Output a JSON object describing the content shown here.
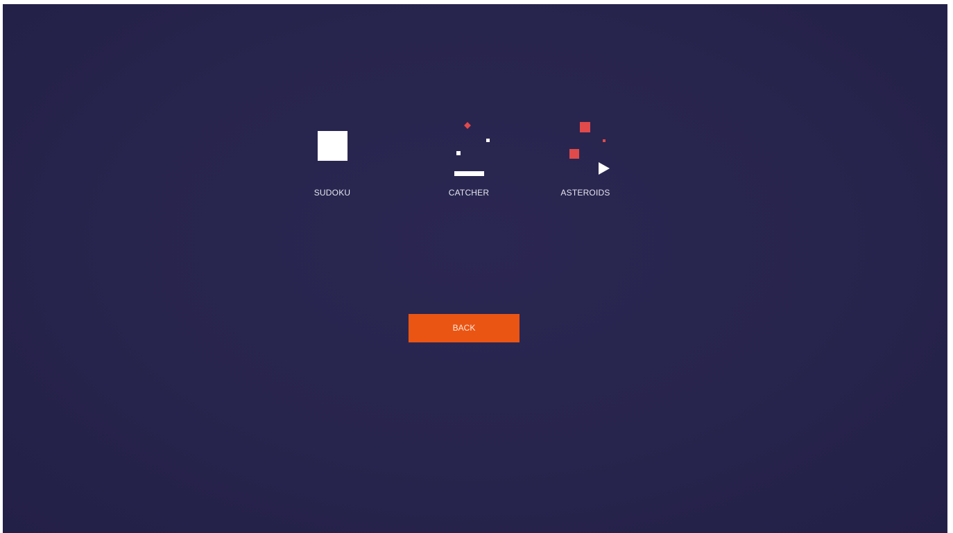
{
  "menu": {
    "games": [
      {
        "label": "SUDOKU",
        "icon": "sudoku-icon"
      },
      {
        "label": "CATCHER",
        "icon": "catcher-icon"
      },
      {
        "label": "ASTEROIDS",
        "icon": "asteroids-icon"
      }
    ],
    "back_label": "BACK"
  },
  "colors": {
    "background": "#27244d",
    "accent": "#ea5513",
    "red": "#e04a4a",
    "white": "#ffffff"
  }
}
